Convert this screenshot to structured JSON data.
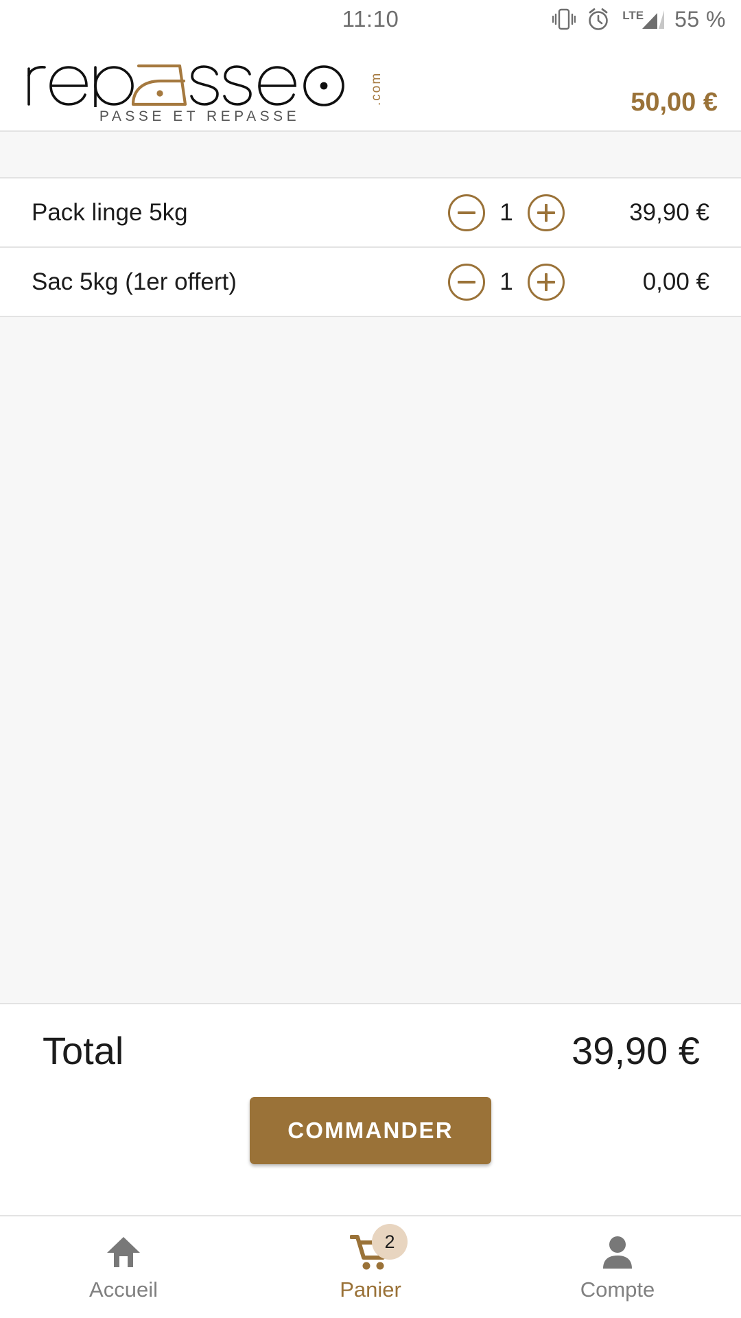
{
  "statusbar": {
    "time": "11:10",
    "battery": "55 %",
    "network_label": "LTE",
    "icons": [
      "vibrate-icon",
      "alarm-icon",
      "signal-icon"
    ]
  },
  "header": {
    "brand_black_1": "rep",
    "brand_iron": "a",
    "brand_black_2": "sseo",
    "dotcom": ".com",
    "tagline": "PASSE ET REPASSE",
    "wallet_amount": "50,00 €"
  },
  "cart": {
    "items": [
      {
        "name": "Pack linge 5kg",
        "qty": "1",
        "price": "39,90 €",
        "minus": "−",
        "plus": "+"
      },
      {
        "name": "Sac 5kg (1er offert)",
        "qty": "1",
        "price": "0,00 €",
        "minus": "−",
        "plus": "+"
      }
    ]
  },
  "summary": {
    "total_label": "Total",
    "total_value": "39,90 €",
    "order_button": "COMMANDER"
  },
  "bottomnav": {
    "items": [
      {
        "label": "Accueil",
        "icon": "home-icon",
        "active": false
      },
      {
        "label": "Panier",
        "icon": "cart-icon",
        "active": true,
        "badge": "2"
      },
      {
        "label": "Compte",
        "icon": "person-icon",
        "active": false
      }
    ]
  },
  "colors": {
    "brand_brown": "#9a7238",
    "badge_bg": "#e8d5c0",
    "muted_grey": "#808080",
    "panel_grey": "#f7f7f7"
  }
}
